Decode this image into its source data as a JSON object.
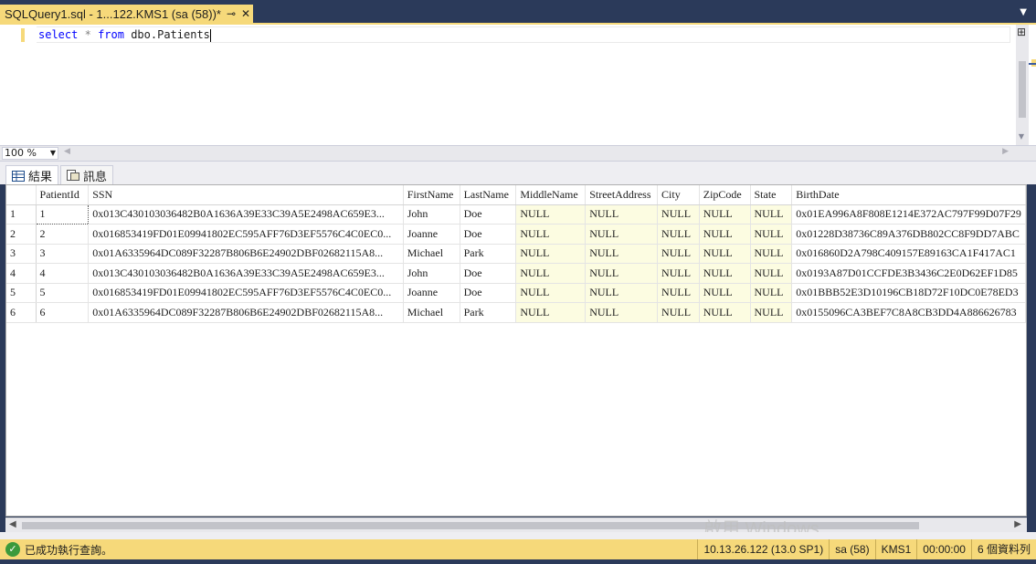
{
  "document_tab": {
    "title": "SQLQuery1.sql - 1...122.KMS1 (sa (58))*",
    "pin_icon": "pin-icon",
    "close_icon": "close-icon"
  },
  "editor": {
    "query_tokens": {
      "kw1": "select",
      "star": "*",
      "kw2": "from",
      "object": "dbo.Patients"
    }
  },
  "zoom": {
    "value": "100 %"
  },
  "result_tabs": [
    {
      "label": "結果",
      "icon": "grid-icon",
      "active": true
    },
    {
      "label": "訊息",
      "icon": "messages-icon",
      "active": false
    }
  ],
  "grid": {
    "columns": [
      "",
      "PatientId",
      "SSN",
      "FirstName",
      "LastName",
      "MiddleName",
      "StreetAddress",
      "City",
      "ZipCode",
      "State",
      "BirthDate"
    ],
    "rows": [
      [
        "1",
        "1",
        "0x013C430103036482B0A1636A39E33C39A5E2498AC659E3...",
        "John",
        "Doe",
        "NULL",
        "NULL",
        "NULL",
        "NULL",
        "NULL",
        "0x01EA996A8F808E1214E372AC797F99D07F29"
      ],
      [
        "2",
        "2",
        "0x016853419FD01E09941802EC595AFF76D3EF5576C4C0EC0...",
        "Joanne",
        "Doe",
        "NULL",
        "NULL",
        "NULL",
        "NULL",
        "NULL",
        "0x01228D38736C89A376DB802CC8F9DD7ABC"
      ],
      [
        "3",
        "3",
        "0x01A6335964DC089F32287B806B6E24902DBF02682115A8...",
        "Michael",
        "Park",
        "NULL",
        "NULL",
        "NULL",
        "NULL",
        "NULL",
        "0x016860D2A798C409157E89163CA1F417AC1"
      ],
      [
        "4",
        "4",
        "0x013C430103036482B0A1636A39E33C39A5E2498AC659E3...",
        "John",
        "Doe",
        "NULL",
        "NULL",
        "NULL",
        "NULL",
        "NULL",
        "0x0193A87D01CCFDE3B3436C2E0D62EF1D85"
      ],
      [
        "5",
        "5",
        "0x016853419FD01E09941802EC595AFF76D3EF5576C4C0EC0...",
        "Joanne",
        "Doe",
        "NULL",
        "NULL",
        "NULL",
        "NULL",
        "NULL",
        "0x01BBB52E3D10196CB18D72F10DC0E78ED3"
      ],
      [
        "6",
        "6",
        "0x01A6335964DC089F32287B806B6E24902DBF02682115A8...",
        "Michael",
        "Park",
        "NULL",
        "NULL",
        "NULL",
        "NULL",
        "NULL",
        "0x0155096CA3BEF7C8A8CB3DD4A886626783"
      ]
    ]
  },
  "status": {
    "message": "已成功執行查詢。",
    "server": "10.13.26.122 (13.0 SP1)",
    "login": "sa (58)",
    "database": "KMS1",
    "elapsed": "00:00:00",
    "row_count": "6 個資料列"
  },
  "watermark": {
    "text": "啟用 Windows"
  },
  "colors": {
    "accent_yellow": "#f6d97a",
    "frame_navy": "#2b3a5a",
    "null_cell": "#fcfce1",
    "keyword_blue": "#0000ff"
  }
}
